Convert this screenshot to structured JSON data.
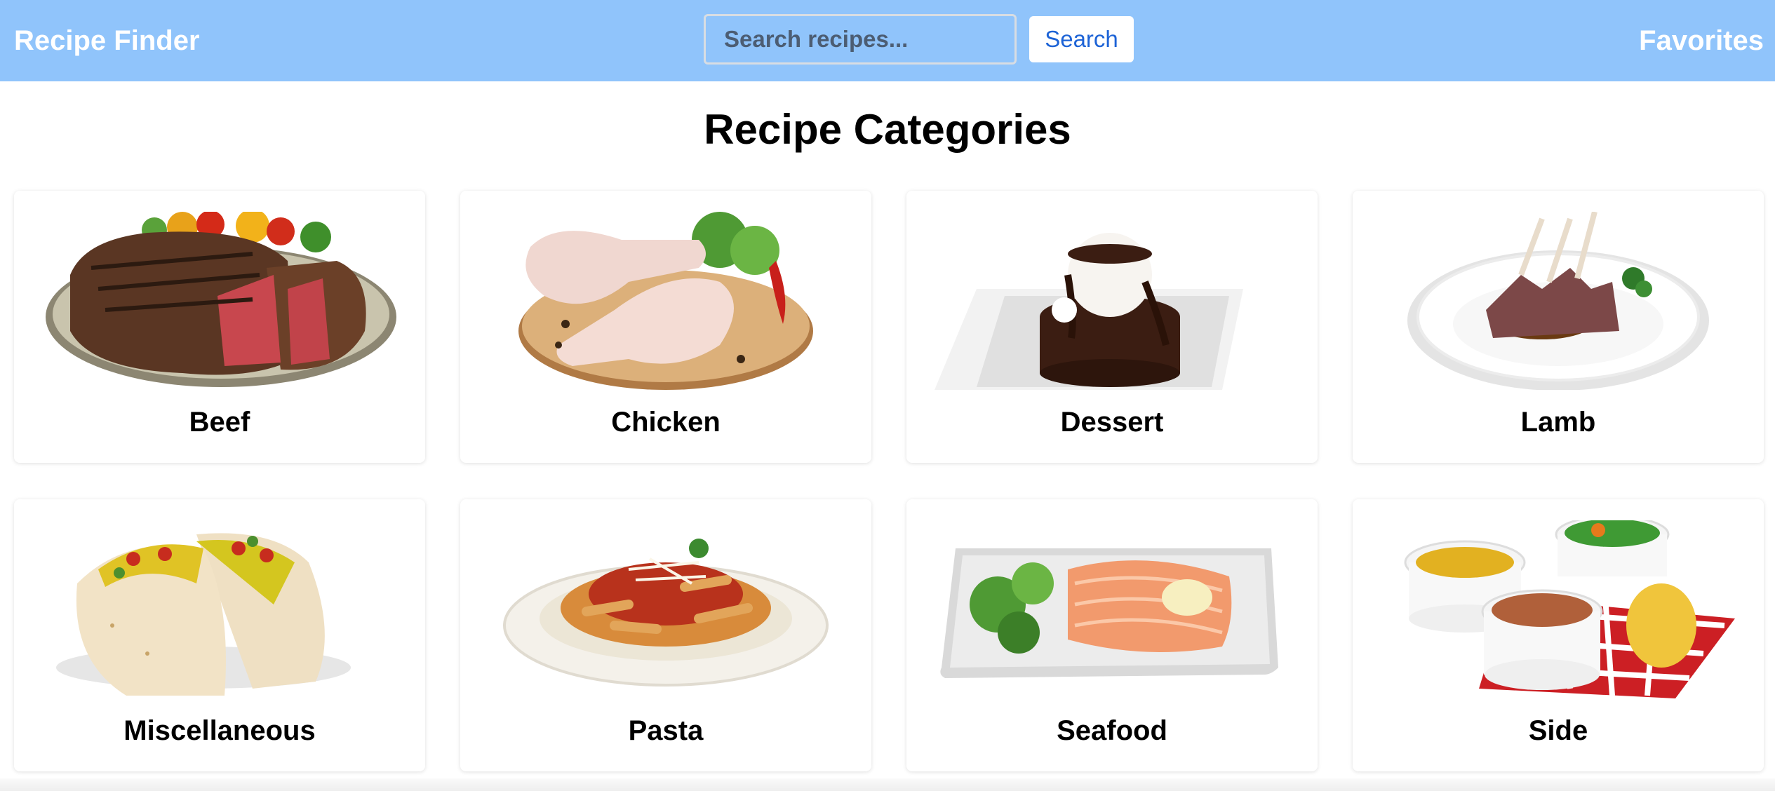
{
  "navbar": {
    "brand": "Recipe Finder",
    "search_placeholder": "Search recipes...",
    "search_value": "",
    "search_button": "Search",
    "favorites": "Favorites",
    "background_color": "#90c4fb"
  },
  "main": {
    "title": "Recipe Categories",
    "categories": [
      {
        "label": "Beef",
        "image": "grilled-steak-image"
      },
      {
        "label": "Chicken",
        "image": "raw-chicken-legs-image"
      },
      {
        "label": "Dessert",
        "image": "chocolate-cake-image"
      },
      {
        "label": "Lamb",
        "image": "lamb-rack-image"
      },
      {
        "label": "Miscellaneous",
        "image": "tacos-image"
      },
      {
        "label": "Pasta",
        "image": "penne-pasta-image"
      },
      {
        "label": "Seafood",
        "image": "salmon-platter-image"
      },
      {
        "label": "Side",
        "image": "side-dishes-image"
      }
    ]
  }
}
